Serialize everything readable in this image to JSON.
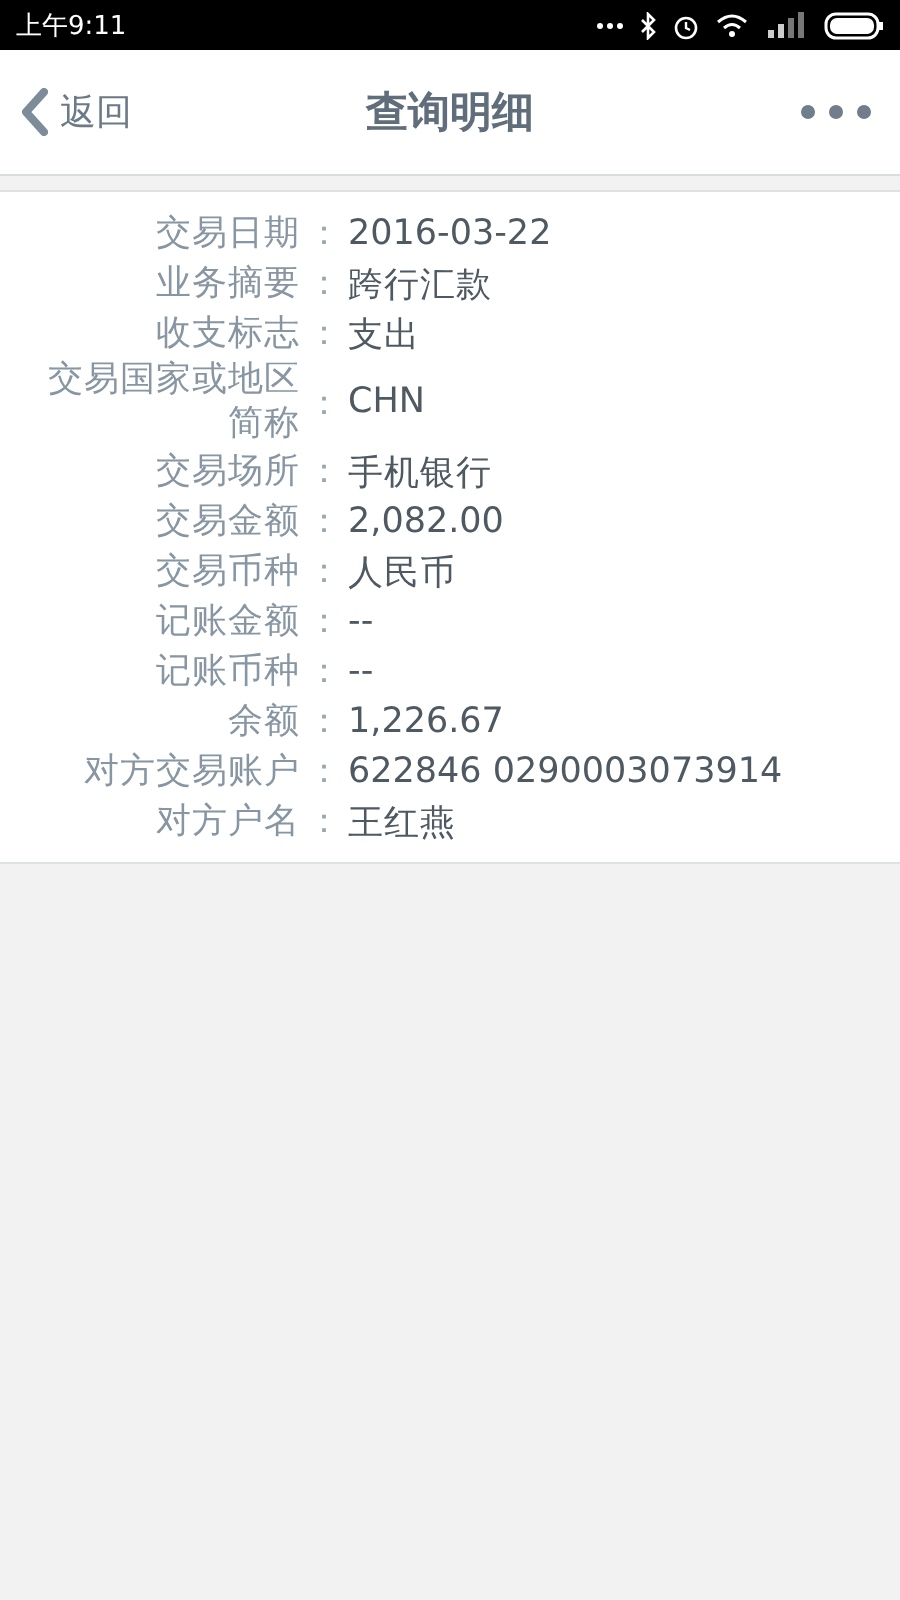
{
  "status_bar": {
    "time": "上午9:11"
  },
  "nav": {
    "back": "返回",
    "title": "查询明细"
  },
  "details": [
    {
      "label": "交易日期",
      "value": "2016-03-22"
    },
    {
      "label": "业务摘要",
      "value": "跨行汇款"
    },
    {
      "label": "收支标志",
      "value": "支出"
    },
    {
      "label": "交易国家或地区简称",
      "value": "CHN"
    },
    {
      "label": "交易场所",
      "value": "手机银行"
    },
    {
      "label": "交易金额",
      "value": "2,082.00"
    },
    {
      "label": "交易币种",
      "value": "人民币"
    },
    {
      "label": "记账金额",
      "value": "--"
    },
    {
      "label": "记账币种",
      "value": "--"
    },
    {
      "label": "余额",
      "value": "1,226.67"
    },
    {
      "label": "对方交易账户",
      "value": "622846 0290003073914"
    },
    {
      "label": "对方户名",
      "value": "王红燕"
    }
  ],
  "separator": "："
}
